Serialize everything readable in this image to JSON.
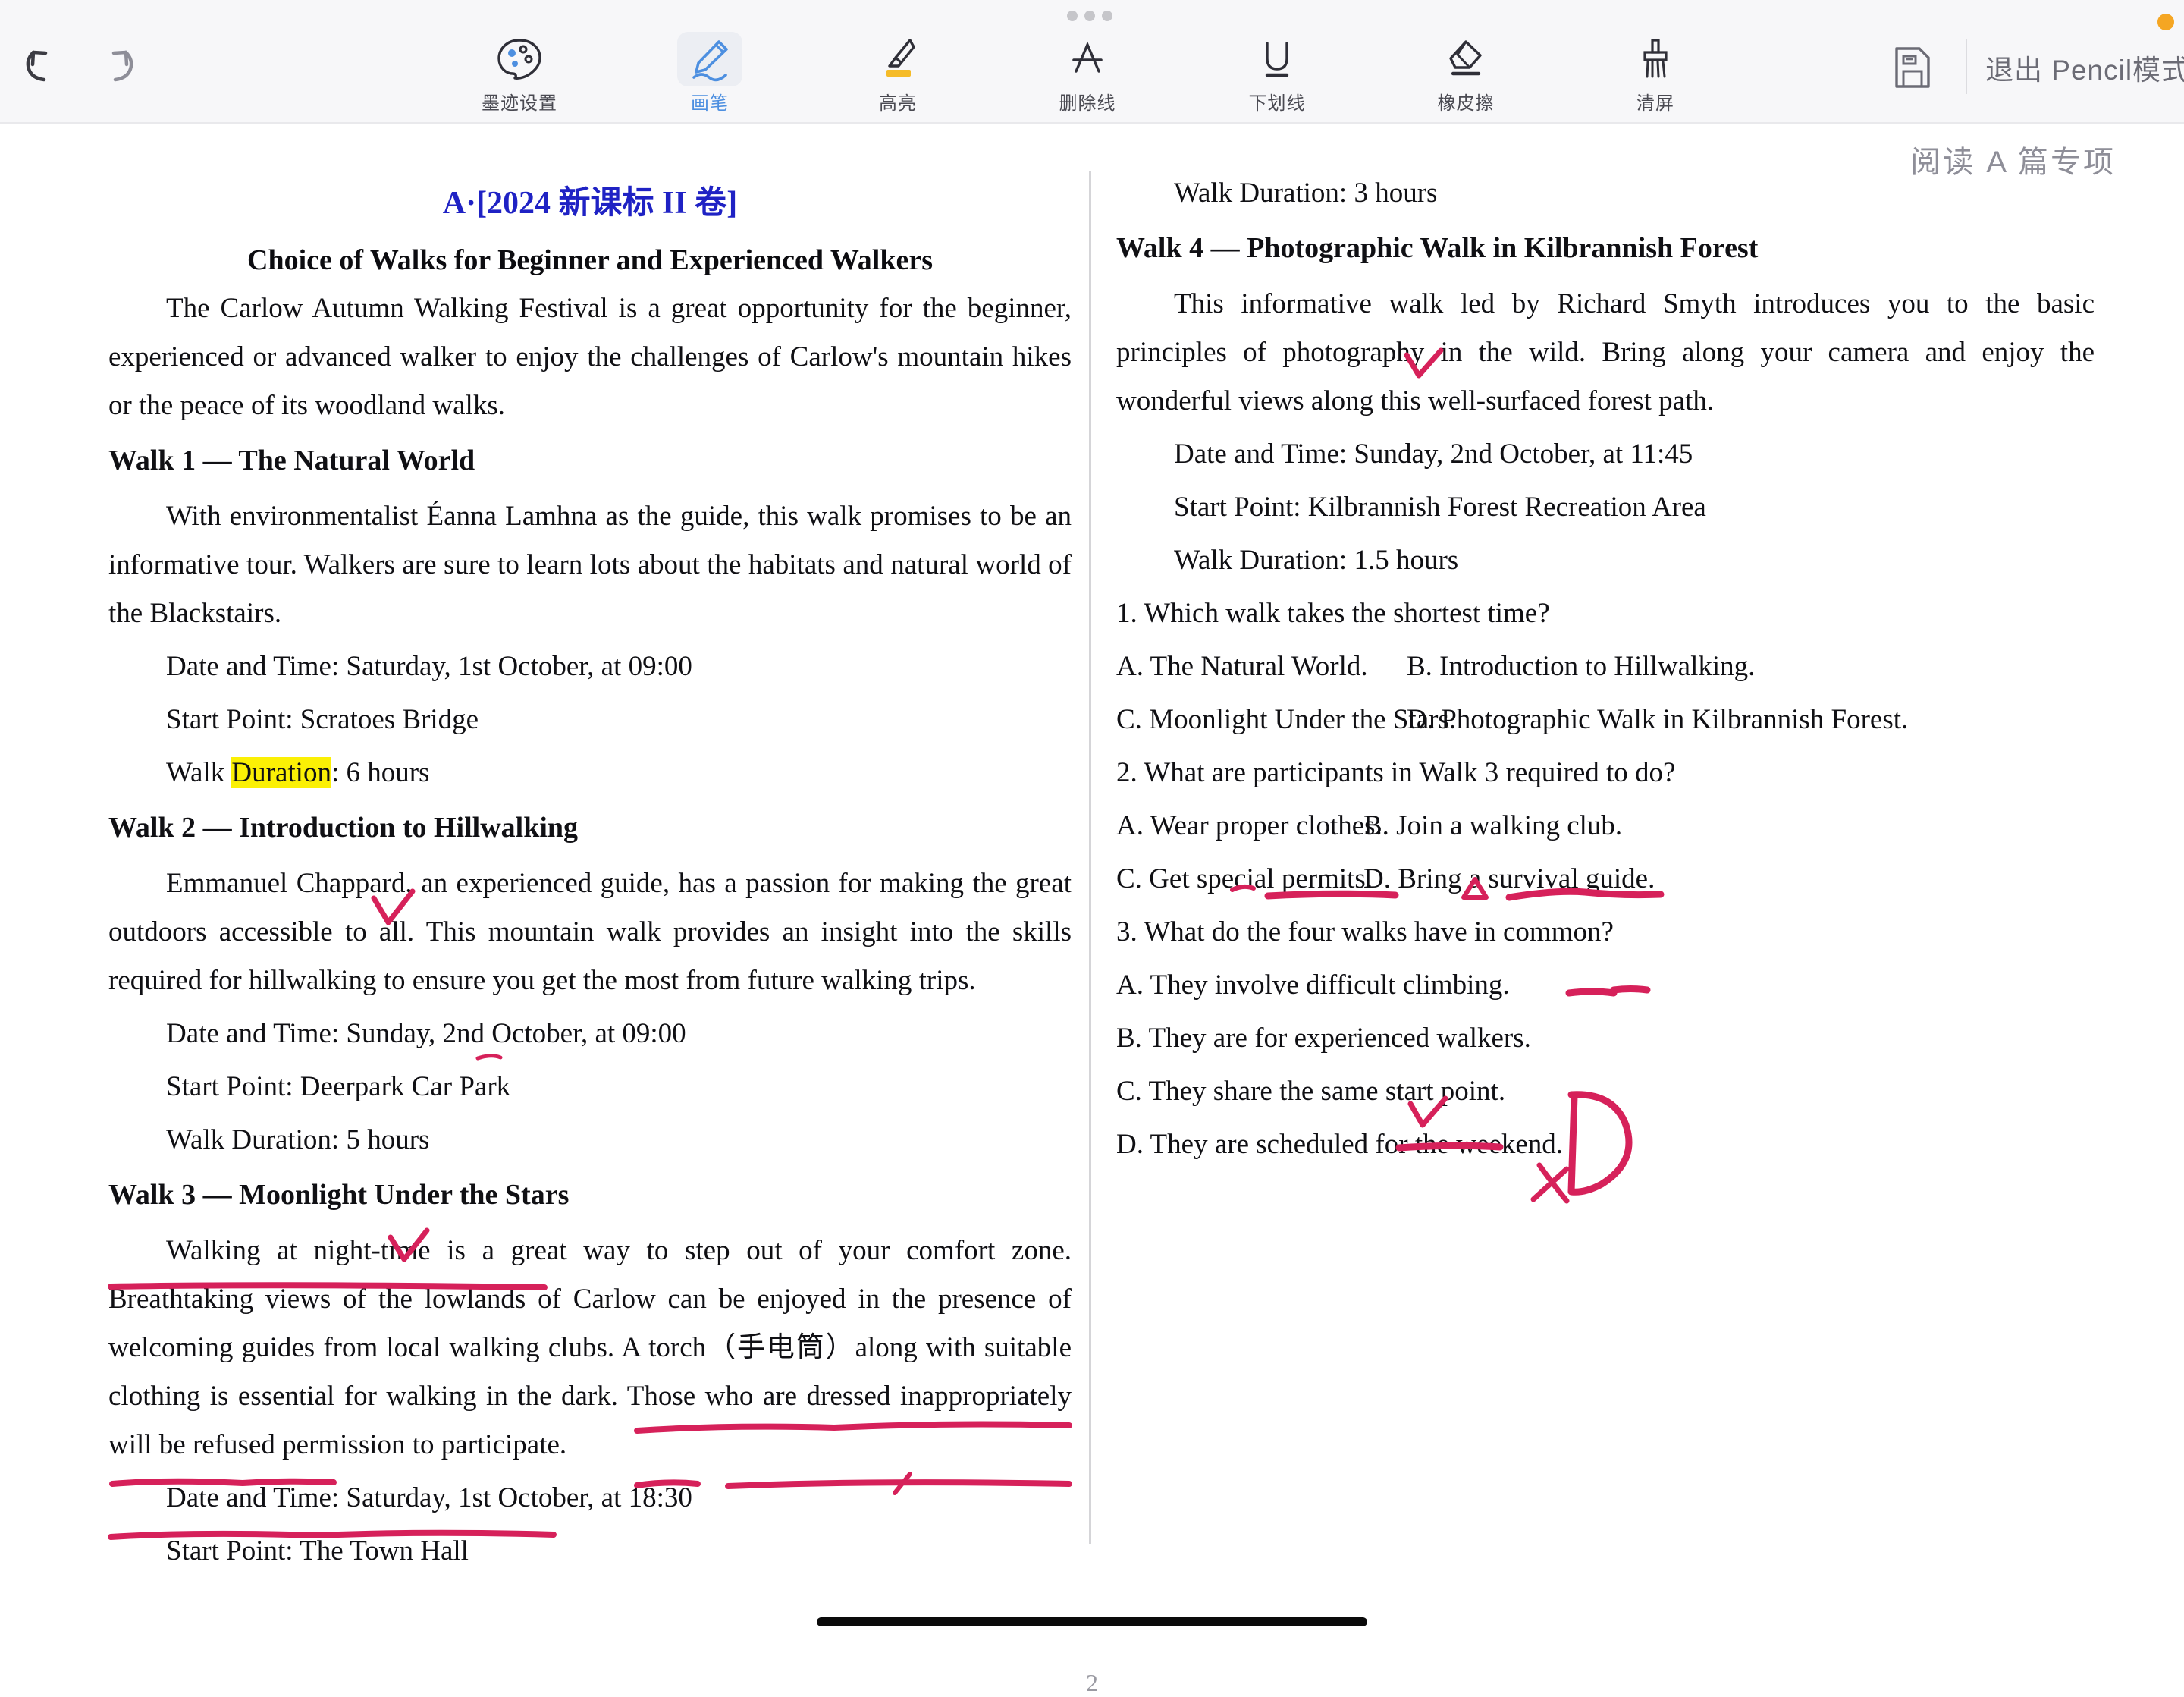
{
  "toolbar": {
    "undo": "undo-arrow",
    "redo": "redo-arrow",
    "tools": [
      {
        "id": "ink-settings",
        "label": "墨迹设置",
        "icon": "palette-icon",
        "active": false
      },
      {
        "id": "pen",
        "label": "画笔",
        "icon": "pen-icon",
        "active": true
      },
      {
        "id": "highlight",
        "label": "高亮",
        "icon": "highlighter-icon",
        "active": false
      },
      {
        "id": "strikethrough",
        "label": "删除线",
        "icon": "strikethrough-icon",
        "active": false
      },
      {
        "id": "underline",
        "label": "下划线",
        "icon": "underline-icon",
        "active": false
      },
      {
        "id": "eraser",
        "label": "橡皮擦",
        "icon": "eraser-icon",
        "active": false
      },
      {
        "id": "clear",
        "label": "清屏",
        "icon": "brush-icon",
        "active": false
      }
    ],
    "save_icon": "save-document-icon",
    "exit_label": "退出 Pencil模式",
    "accent_color": "#4d8fe0",
    "notification_dot_color": "#f5a623"
  },
  "page": {
    "section_title": "阅读 A 篇专项",
    "page_number": "2",
    "doc_title": "A·[2024 新课标 II 卷]",
    "doc_title_color": "#1f22c4",
    "doc_subtitle": "Choice of Walks for Beginner and Experienced Walkers"
  },
  "left_column": {
    "intro": "The Carlow Autumn Walking Festival is a great opportunity for the beginner, experienced or advanced walker to enjoy the challenges of Carlow's mountain hikes or the peace of its woodland walks.",
    "walk1": {
      "heading": "Walk 1 — The Natural World",
      "body": "With environmentalist Éanna Lamhna as the guide, this walk promises to be an informative tour. Walkers are sure to learn lots about the habitats and natural world of the Blackstairs.",
      "date": "Date and Time: Saturday, 1st October, at 09:00",
      "start": "Start Point: Scratoes Bridge",
      "duration_pre": "Walk ",
      "duration_hl": "Duration",
      "duration_post": ": 6 hours"
    },
    "walk2": {
      "heading": "Walk 2 — Introduction to Hillwalking",
      "body": "Emmanuel Chappard, an experienced guide, has a passion for making the great outdoors accessible to all. This mountain walk provides an insight into the skills required for hillwalking to ensure you get the most from future walking trips.",
      "date": "Date and Time: Sunday, 2nd October, at 09:00",
      "start": "Start Point: Deerpark Car Park",
      "duration": "Walk Duration: 5 hours"
    },
    "walk3": {
      "heading": "Walk 3 — Moonlight Under the Stars",
      "body": "Walking at night-time is a great way to step out of your comfort zone. Breathtaking views of the lowlands of Carlow can be enjoyed in the presence of welcoming guides from local walking clubs. A torch（手电筒）along with suitable clothing is essential for walking in the dark. Those who are dressed inappropriately will be refused permission to participate.",
      "date": "Date and Time: Saturday, 1st October, at 18:30",
      "start": "Start Point: The Town Hall"
    }
  },
  "right_column": {
    "walk3_duration": "Walk Duration: 3 hours",
    "walk4": {
      "heading": "Walk 4 — Photographic Walk in Kilbrannish Forest",
      "body": "This informative walk led by Richard Smyth introduces you to the basic principles of photography in the wild. Bring along your camera and enjoy the wonderful views along this well-surfaced forest path.",
      "date": "Date and Time: Sunday, 2nd October, at 11:45",
      "start": "Start Point: Kilbrannish Forest Recreation Area",
      "duration": "Walk Duration: 1.5 hours"
    },
    "questions": [
      {
        "stem": "1. Which walk takes the shortest time?",
        "a": "A. The Natural World.",
        "b": "B. Introduction to Hillwalking.",
        "c": "C. Moonlight Under the Stars.",
        "d": "D. Photographic Walk in Kilbrannish Forest."
      },
      {
        "stem": "2. What are participants in Walk 3 required to do?",
        "a": "A. Wear proper clothes.",
        "b": "B. Join a walking club.",
        "c": "C. Get special permits.",
        "d": "D. Bring a survival guide."
      },
      {
        "stem": "3. What do the four walks have in common?",
        "a": "A. They involve difficult climbing.",
        "b": "B. They are for experienced walkers.",
        "c": "C. They share the same start point.",
        "d": "D. They are scheduled for the weekend."
      }
    ]
  },
  "annotations": {
    "ink_color": "#d6215a",
    "highlight_color": "#fbf005",
    "handwritten_answer_q1": "D"
  }
}
